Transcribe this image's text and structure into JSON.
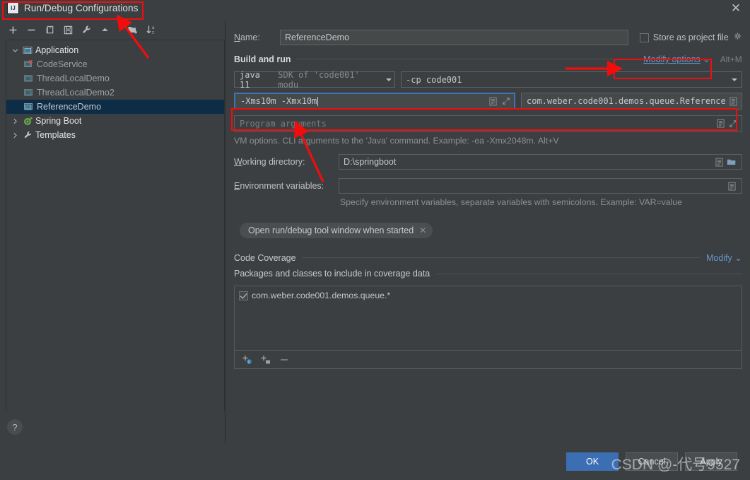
{
  "window": {
    "title": "Run/Debug Configurations",
    "logo_text": "IJ",
    "close_icon": "close-icon"
  },
  "toolbar": {
    "buttons": [
      {
        "name": "add-configuration-button",
        "icon": "plus-icon",
        "label": "+"
      },
      {
        "name": "remove-configuration-button",
        "icon": "minus-icon",
        "label": "−"
      },
      {
        "name": "copy-configuration-button",
        "icon": "copy-icon",
        "label": "Copy"
      },
      {
        "name": "save-configuration-button",
        "icon": "save-icon",
        "label": "Save"
      },
      {
        "name": "edit-templates-button",
        "icon": "wrench-icon",
        "label": "Edit Templates"
      },
      {
        "name": "move-up-button",
        "icon": "arrow-up-icon",
        "label": "Move Up"
      },
      {
        "name": "new-folder-button",
        "icon": "folder-add-icon",
        "label": "New Folder"
      },
      {
        "name": "sort-button",
        "icon": "sort-az-icon",
        "label": "Sort"
      }
    ]
  },
  "tree": {
    "items": [
      {
        "label": "Application",
        "type": "group",
        "expanded": true,
        "icon": "application-icon",
        "arrow": "chevron-down-icon"
      },
      {
        "label": "CodeService",
        "type": "child",
        "icon": "application-error-icon",
        "selected": false
      },
      {
        "label": "ThreadLocalDemo",
        "type": "child",
        "icon": "application-icon",
        "selected": false
      },
      {
        "label": "ThreadLocalDemo2",
        "type": "child",
        "icon": "application-icon",
        "selected": false
      },
      {
        "label": "ReferenceDemo",
        "type": "child",
        "icon": "application-icon",
        "selected": true
      },
      {
        "label": "Spring Boot",
        "type": "group",
        "expanded": false,
        "icon": "spring-boot-icon",
        "arrow": "chevron-right-icon"
      },
      {
        "label": "Templates",
        "type": "group",
        "expanded": false,
        "icon": "wrench-icon",
        "arrow": "chevron-right-icon"
      }
    ]
  },
  "help": {
    "label": "?"
  },
  "form": {
    "name_label": "Name:",
    "name_value": "ReferenceDemo",
    "store_as_project_file_label": "Store as project file",
    "store_as_project_file_checked": false,
    "gear_icon": "gear-icon",
    "build_and_run_title": "Build and run",
    "modify_options_label": "Modify options",
    "modify_options_shortcut": "Alt+M",
    "sdk_value_prefix": "java 11",
    "sdk_value_suffix": "SDK of 'code001' modu",
    "classpath_value": "-cp code001",
    "vm_options_value": "-Xms10m -Xmx10m",
    "main_class_value": "com.weber.code001.demos.queue.Reference",
    "program_arguments_placeholder": "Program arguments",
    "vm_options_hint": "VM options. CLI arguments to the 'Java' command. Example: -ea -Xmx2048m. Alt+V",
    "working_directory_label": "Working directory:",
    "working_directory_value": "D:\\springboot",
    "environment_variables_label": "Environment variables:",
    "environment_variables_value": "",
    "environment_variables_hint": "Specify environment variables, separate variables with semicolons. Example: VAR=value",
    "chip_label": "Open run/debug tool window when started",
    "chip_close_icon": "close-icon"
  },
  "coverage": {
    "section_title": "Code Coverage",
    "modify_label": "Modify",
    "packages_title": "Packages and classes to include in coverage data",
    "items": [
      {
        "label": "com.weber.code001.demos.queue.*",
        "checked": true
      }
    ],
    "toolbar": [
      {
        "name": "add-class-button",
        "icon": "add-class-icon"
      },
      {
        "name": "add-package-button",
        "icon": "add-package-icon"
      },
      {
        "name": "remove-pattern-button",
        "icon": "minus-icon"
      }
    ]
  },
  "footer": {
    "ok_label": "OK",
    "cancel_label": "Cancel",
    "apply_label": "Apply"
  },
  "watermark": {
    "text": "CSDN @-代号9527"
  },
  "colors": {
    "accent_blue": "#3c6eb4",
    "link_blue": "#6699cc",
    "annotation_red": "#f20d0d",
    "selection_navy": "#0d2d46",
    "panel_bg": "#3c3f41",
    "field_bg": "#45494a"
  }
}
